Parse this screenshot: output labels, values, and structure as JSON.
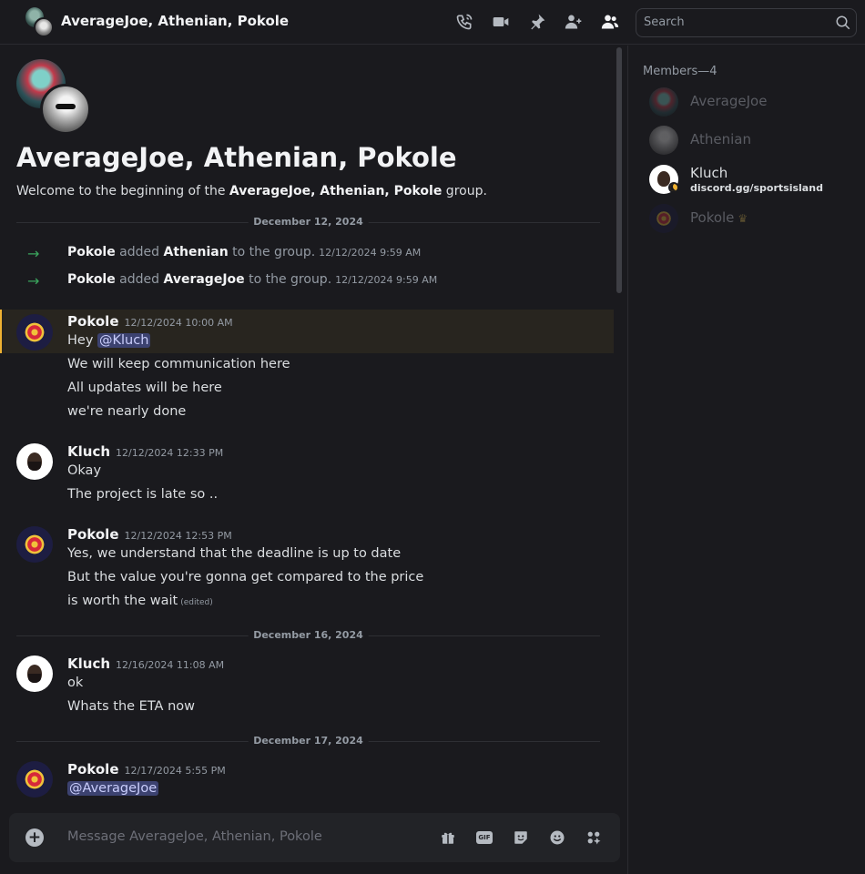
{
  "header": {
    "title": "AverageJoe, Athenian, Pokole",
    "icons": [
      "phone-call-icon",
      "video-camera-icon",
      "pin-icon",
      "add-friend-icon",
      "members-icon"
    ],
    "search_placeholder": "Search"
  },
  "welcome": {
    "title": "AverageJoe, Athenian, Pokole",
    "text_before": "Welcome to the beginning of the ",
    "group_name": "AverageJoe, Athenian, Pokole",
    "text_after": " group."
  },
  "dates": [
    "December 12, 2024",
    "December 16, 2024",
    "December 17, 2024"
  ],
  "system_messages": [
    {
      "actor": "Pokole",
      "verb": " added ",
      "target": "Athenian",
      "rest": " to the group.",
      "time": "12/12/2024 9:59 AM"
    },
    {
      "actor": "Pokole",
      "verb": " added ",
      "target": "AverageJoe",
      "rest": " to the group.",
      "time": "12/12/2024 9:59 AM"
    }
  ],
  "messages": [
    {
      "author": "Pokole",
      "time": "12/12/2024 10:00 AM",
      "line1_prefix": "Hey ",
      "mention": "@Kluch",
      "lines": [
        "We will keep communication here",
        "All updates will be here",
        "we're nearly done"
      ]
    },
    {
      "author": "Kluch",
      "time": "12/12/2024 12:33 PM",
      "lines": [
        "Okay",
        "The project is late so .."
      ]
    },
    {
      "author": "Pokole",
      "time": "12/12/2024 12:53 PM",
      "lines": [
        "Yes, we understand that the deadline is up to date",
        "But the value you're gonna get compared to the price",
        "is worth the wait"
      ],
      "edited": "(edited)"
    },
    {
      "author": "Kluch",
      "time": "12/16/2024 11:08 AM",
      "lines": [
        "ok",
        "Whats the ETA now"
      ]
    },
    {
      "author": "Pokole",
      "time": "12/17/2024 5:55 PM",
      "mention": "@AverageJoe"
    }
  ],
  "composer": {
    "placeholder": "Message AverageJoe, Athenian, Pokole",
    "gif_label": "GIF"
  },
  "members": {
    "title": "Members—4",
    "list": [
      {
        "name": "AverageJoe"
      },
      {
        "name": "Athenian"
      },
      {
        "name": "Kluch",
        "status": "discord.gg/sportsisland"
      },
      {
        "name": "Pokole"
      }
    ]
  },
  "colors": {
    "background": "#1a1a1e",
    "mention_bg": "#3c4270",
    "highlight_bar": "#f0b232",
    "system_arrow": "#3ba55d"
  }
}
